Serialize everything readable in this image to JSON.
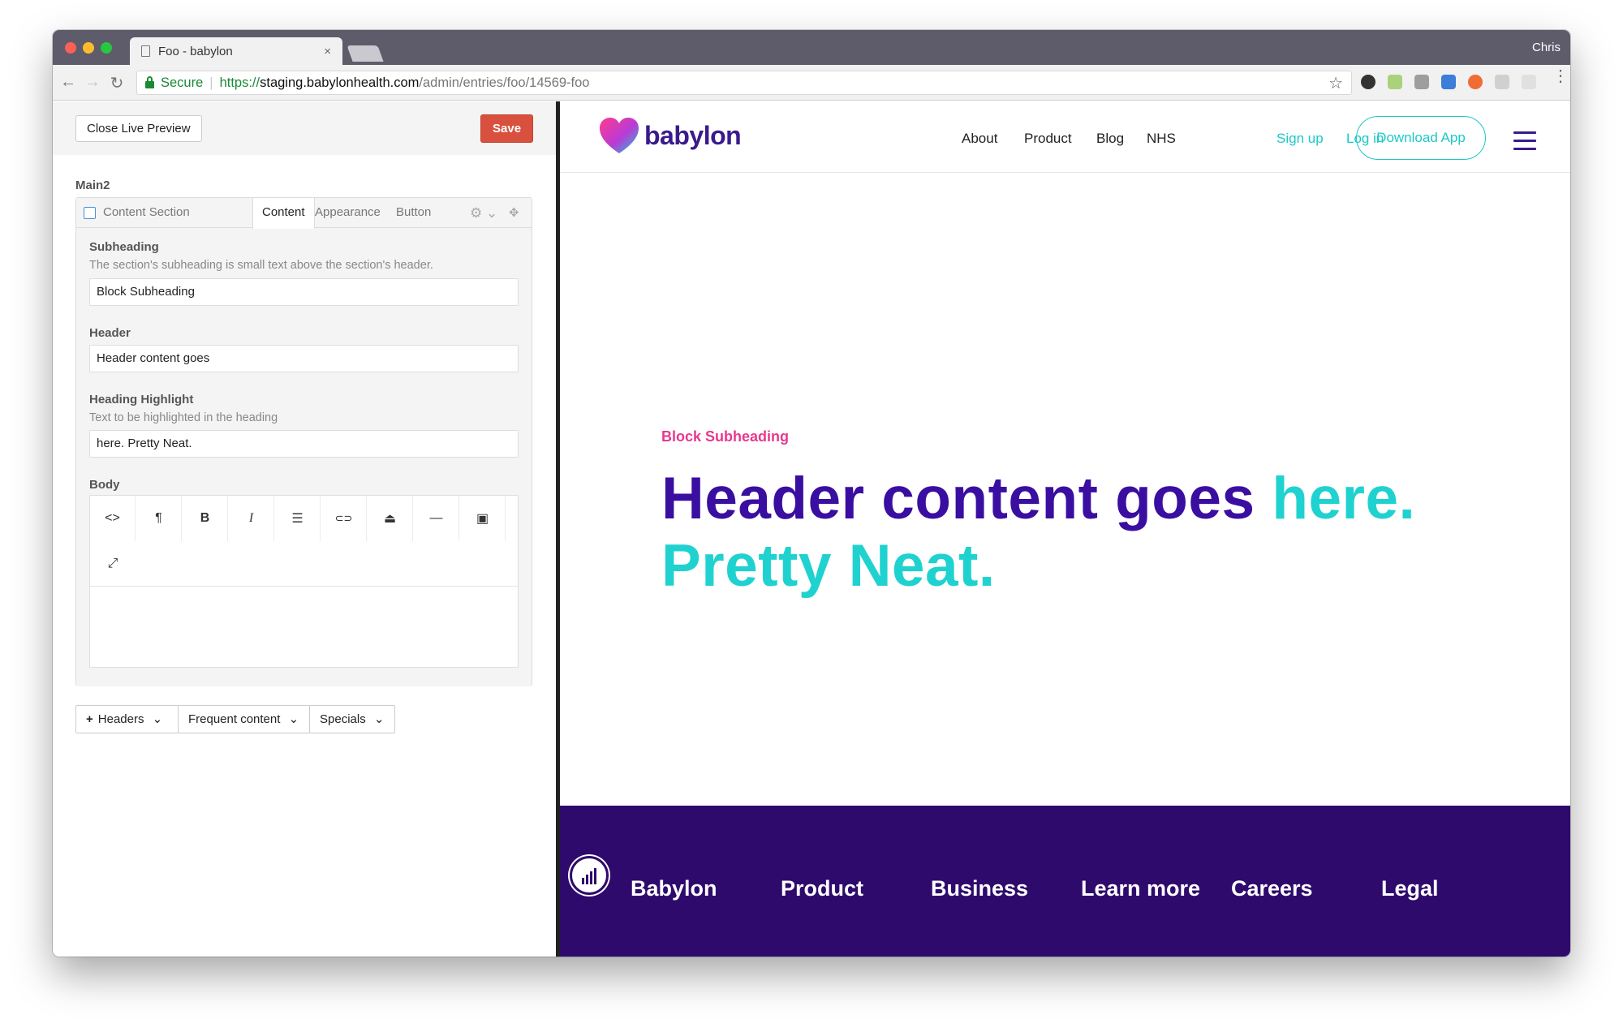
{
  "browser": {
    "tab_title": "Foo - babylon",
    "tab_close": "×",
    "profile_name": "Chris",
    "secure_label": "Secure",
    "url_proto": "https://",
    "url_host": "staging.babylonhealth.com",
    "url_path": "/admin/entries/foo/14569-foo",
    "back_icon": "←",
    "forward_icon": "→",
    "reload_icon": "↻",
    "star_icon": "☆"
  },
  "editor_panel": {
    "close_preview_label": "Close Live Preview",
    "save_label": "Save",
    "section_label": "Main2",
    "block": {
      "type_label": "Content Section",
      "tabs": [
        "Content",
        "Appearance",
        "Button"
      ],
      "active_tab": "Content",
      "fields": {
        "subheading": {
          "label": "Subheading",
          "help": "The section's subheading is small text above the section's header.",
          "value": "Block Subheading"
        },
        "header": {
          "label": "Header",
          "value": "Header content goes"
        },
        "highlight": {
          "label": "Heading Highlight",
          "help": "Text to be highlighted in the heading",
          "value": "here. Pretty Neat."
        },
        "body": {
          "label": "Body",
          "value": ""
        }
      },
      "toolbar": {
        "html": "<>",
        "paragraph": "¶",
        "bold": "B",
        "italic": "I",
        "list": "☰",
        "link": "⊂⊃",
        "embed": "⏏",
        "hr": "—",
        "image": "▣",
        "fullscreen": "⤢"
      }
    },
    "add_buttons": [
      {
        "label": "Headers",
        "icon": "+",
        "caret": "⌄"
      },
      {
        "label": "Frequent content",
        "caret": "⌄"
      },
      {
        "label": "Specials",
        "caret": "⌄"
      }
    ]
  },
  "site": {
    "logo_text": "babylon",
    "nav": [
      "About",
      "Product",
      "Blog",
      "NHS"
    ],
    "sign_up": "Sign up",
    "log_in": "Log in",
    "download_app": "Download App",
    "subheading": "Block Subheading",
    "heading_main": "Header content goes",
    "heading_highlight": "here. Pretty Neat.",
    "footer_links": [
      "Babylon",
      "Product",
      "Business",
      "Learn more",
      "Careers",
      "Legal"
    ],
    "colors": {
      "brand_purple": "#3a0ea0",
      "teal": "#1fd2d0",
      "pink": "#e8398f",
      "footer_bg": "#2e0a6c",
      "save_red": "#d9513e"
    }
  }
}
